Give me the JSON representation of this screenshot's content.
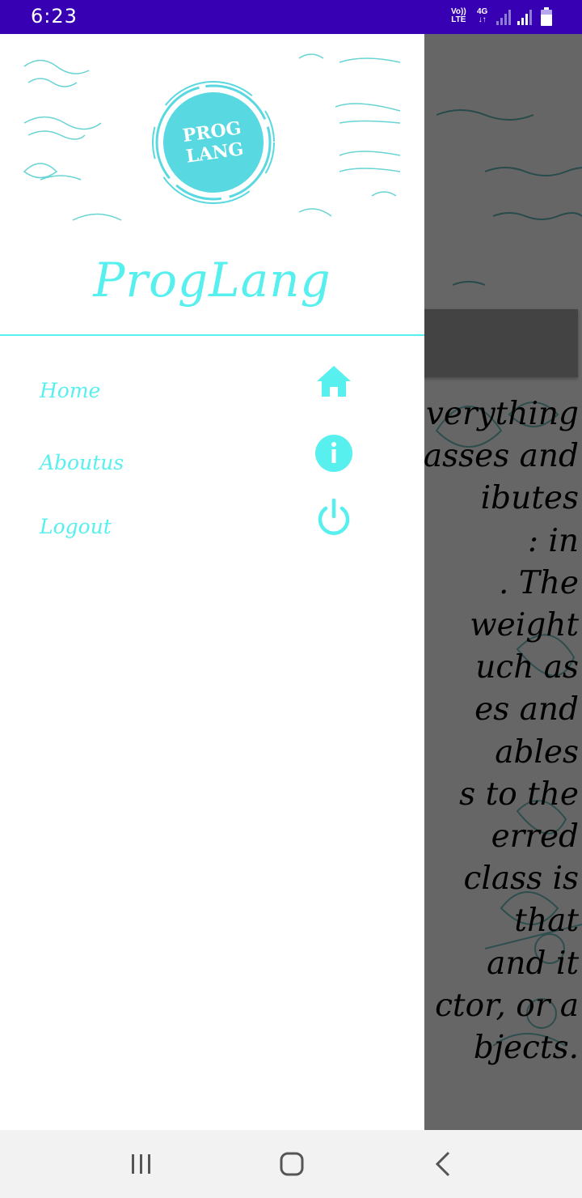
{
  "status_bar": {
    "time": "6:23",
    "volte_line1": "Vo))",
    "volte_line2": "LTE",
    "network": "4G"
  },
  "drawer": {
    "logo_line1": "PROG",
    "logo_line2": "LANG",
    "brand_title": "ProgLang",
    "accent_color": "#58EFEF",
    "menu": [
      {
        "label": "Home",
        "icon": "home-icon"
      },
      {
        "label": "Aboutus",
        "icon": "info-icon"
      },
      {
        "label": "Logout",
        "icon": "power-icon"
      }
    ]
  },
  "background_app": {
    "text_lines": [
      "verything",
      "asses and",
      "ibutes",
      ": in",
      ". The",
      " weight",
      "uch as",
      "es and",
      "ables",
      "s to the",
      "erred",
      "class is",
      "that",
      " and it",
      "ctor, or a",
      "bjects."
    ]
  },
  "nav_bar": {
    "buttons": [
      "recent-apps-icon",
      "home-button-icon",
      "back-icon"
    ]
  }
}
